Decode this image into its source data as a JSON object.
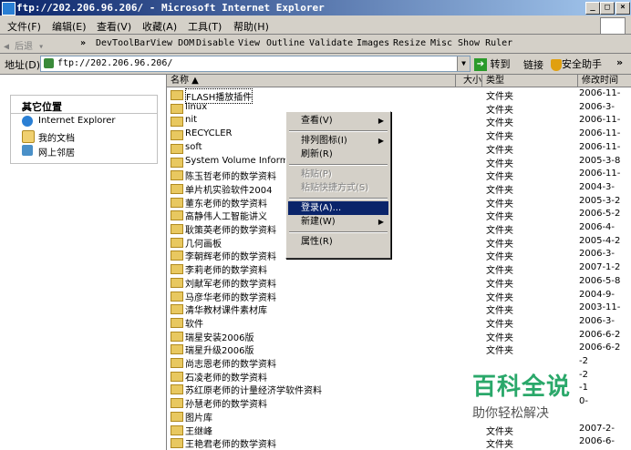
{
  "window": {
    "title": "ftp://202.206.96.206/ - Microsoft Internet Explorer"
  },
  "menu": [
    "文件(F)",
    "编辑(E)",
    "查看(V)",
    "收藏(A)",
    "工具(T)",
    "帮助(H)"
  ],
  "toolbar": {
    "back": "后退",
    "items": [
      "DevToolBar",
      "View DOM",
      "Disable",
      "View",
      "Outline",
      "Validate",
      "Images",
      "Resize",
      "Misc",
      "Show Ruler"
    ]
  },
  "address": {
    "label": "地址(D)",
    "value": "ftp://202.206.96.206/",
    "go": "转到",
    "links": "链接",
    "security": "安全助手"
  },
  "sidebar": {
    "title": "其它位置",
    "items": [
      {
        "icon": "internet-explorer-icon",
        "label": "Internet Explorer"
      },
      {
        "icon": "my-documents-icon",
        "label": "我的文档"
      },
      {
        "icon": "network-places-icon",
        "label": "网上邻居"
      }
    ]
  },
  "columns": {
    "name": "名称 ▲",
    "size": "大小",
    "type": "类型",
    "modified": "修改时间"
  },
  "files": [
    {
      "name": "FLASH播放插件",
      "type": "文件夹",
      "date": "2006-11-"
    },
    {
      "name": "linux",
      "type": "文件夹",
      "date": "2006-3-"
    },
    {
      "name": "nit",
      "type": "文件夹",
      "date": "2006-11-"
    },
    {
      "name": "RECYCLER",
      "type": "文件夹",
      "date": "2006-11-"
    },
    {
      "name": "soft",
      "type": "文件夹",
      "date": "2006-11-"
    },
    {
      "name": "System Volume Informa",
      "type": "文件夹",
      "date": "2005-3-8"
    },
    {
      "name": "陈玉哲老师的数学资料",
      "type": "文件夹",
      "date": "2006-11-"
    },
    {
      "name": "单片机实验软件2004",
      "type": "文件夹",
      "date": "2004-3-"
    },
    {
      "name": "董东老师的数学资料",
      "type": "文件夹",
      "date": "2005-3-2"
    },
    {
      "name": "高静伟人工智能讲义",
      "type": "文件夹",
      "date": "2006-5-2"
    },
    {
      "name": "耿策英老师的数学资料",
      "type": "文件夹",
      "date": "2006-4-"
    },
    {
      "name": "几何画板",
      "type": "文件夹",
      "date": "2005-4-2"
    },
    {
      "name": "李朝辉老师的数学资料",
      "type": "文件夹",
      "date": "2006-3-"
    },
    {
      "name": "李莉老师的数学资料",
      "type": "文件夹",
      "date": "2007-1-2"
    },
    {
      "name": "刘献军老师的数学资料",
      "type": "文件夹",
      "date": "2006-5-8"
    },
    {
      "name": "马彦华老师的数学资料",
      "type": "文件夹",
      "date": "2004-9-"
    },
    {
      "name": "清华教材课件素材库",
      "type": "文件夹",
      "date": "2003-11-"
    },
    {
      "name": "软件",
      "type": "文件夹",
      "date": "2006-3-"
    },
    {
      "name": "瑞星安装2006版",
      "type": "文件夹",
      "date": "2006-6-2"
    },
    {
      "name": "瑞星升级2006版",
      "type": "文件夹",
      "date": "2006-6-2"
    },
    {
      "name": "尚志恩老师的数学资料",
      "type": "",
      "date": "-2"
    },
    {
      "name": "石凌老师的数学资料",
      "type": "",
      "date": "-2"
    },
    {
      "name": "苏红原老师的计量经济学软件资料",
      "type": "",
      "date": "-1"
    },
    {
      "name": "孙慧老师的数学资料",
      "type": "",
      "date": "0-"
    },
    {
      "name": "图片库",
      "type": "",
      "date": ""
    },
    {
      "name": "王继峰",
      "type": "文件夹",
      "date": "2007-2-"
    },
    {
      "name": "王艳君老师的数学资料",
      "type": "文件夹",
      "date": "2006-6-"
    }
  ],
  "context_menu": [
    {
      "label": "查看(V)",
      "submenu": true,
      "state": "normal"
    },
    {
      "sep": true
    },
    {
      "label": "排列图标(I)",
      "submenu": true,
      "state": "normal"
    },
    {
      "label": "刷新(R)",
      "state": "normal"
    },
    {
      "sep": true
    },
    {
      "label": "粘贴(P)",
      "state": "disabled"
    },
    {
      "label": "粘贴快捷方式(S)",
      "state": "disabled"
    },
    {
      "sep": true
    },
    {
      "label": "登录(A)...",
      "state": "highlighted"
    },
    {
      "label": "新建(W)",
      "submenu": true,
      "state": "normal"
    },
    {
      "sep": true
    },
    {
      "label": "属性(R)",
      "state": "normal"
    }
  ],
  "watermark": {
    "title": "百科全说",
    "subtitle": "助你轻松解决"
  }
}
